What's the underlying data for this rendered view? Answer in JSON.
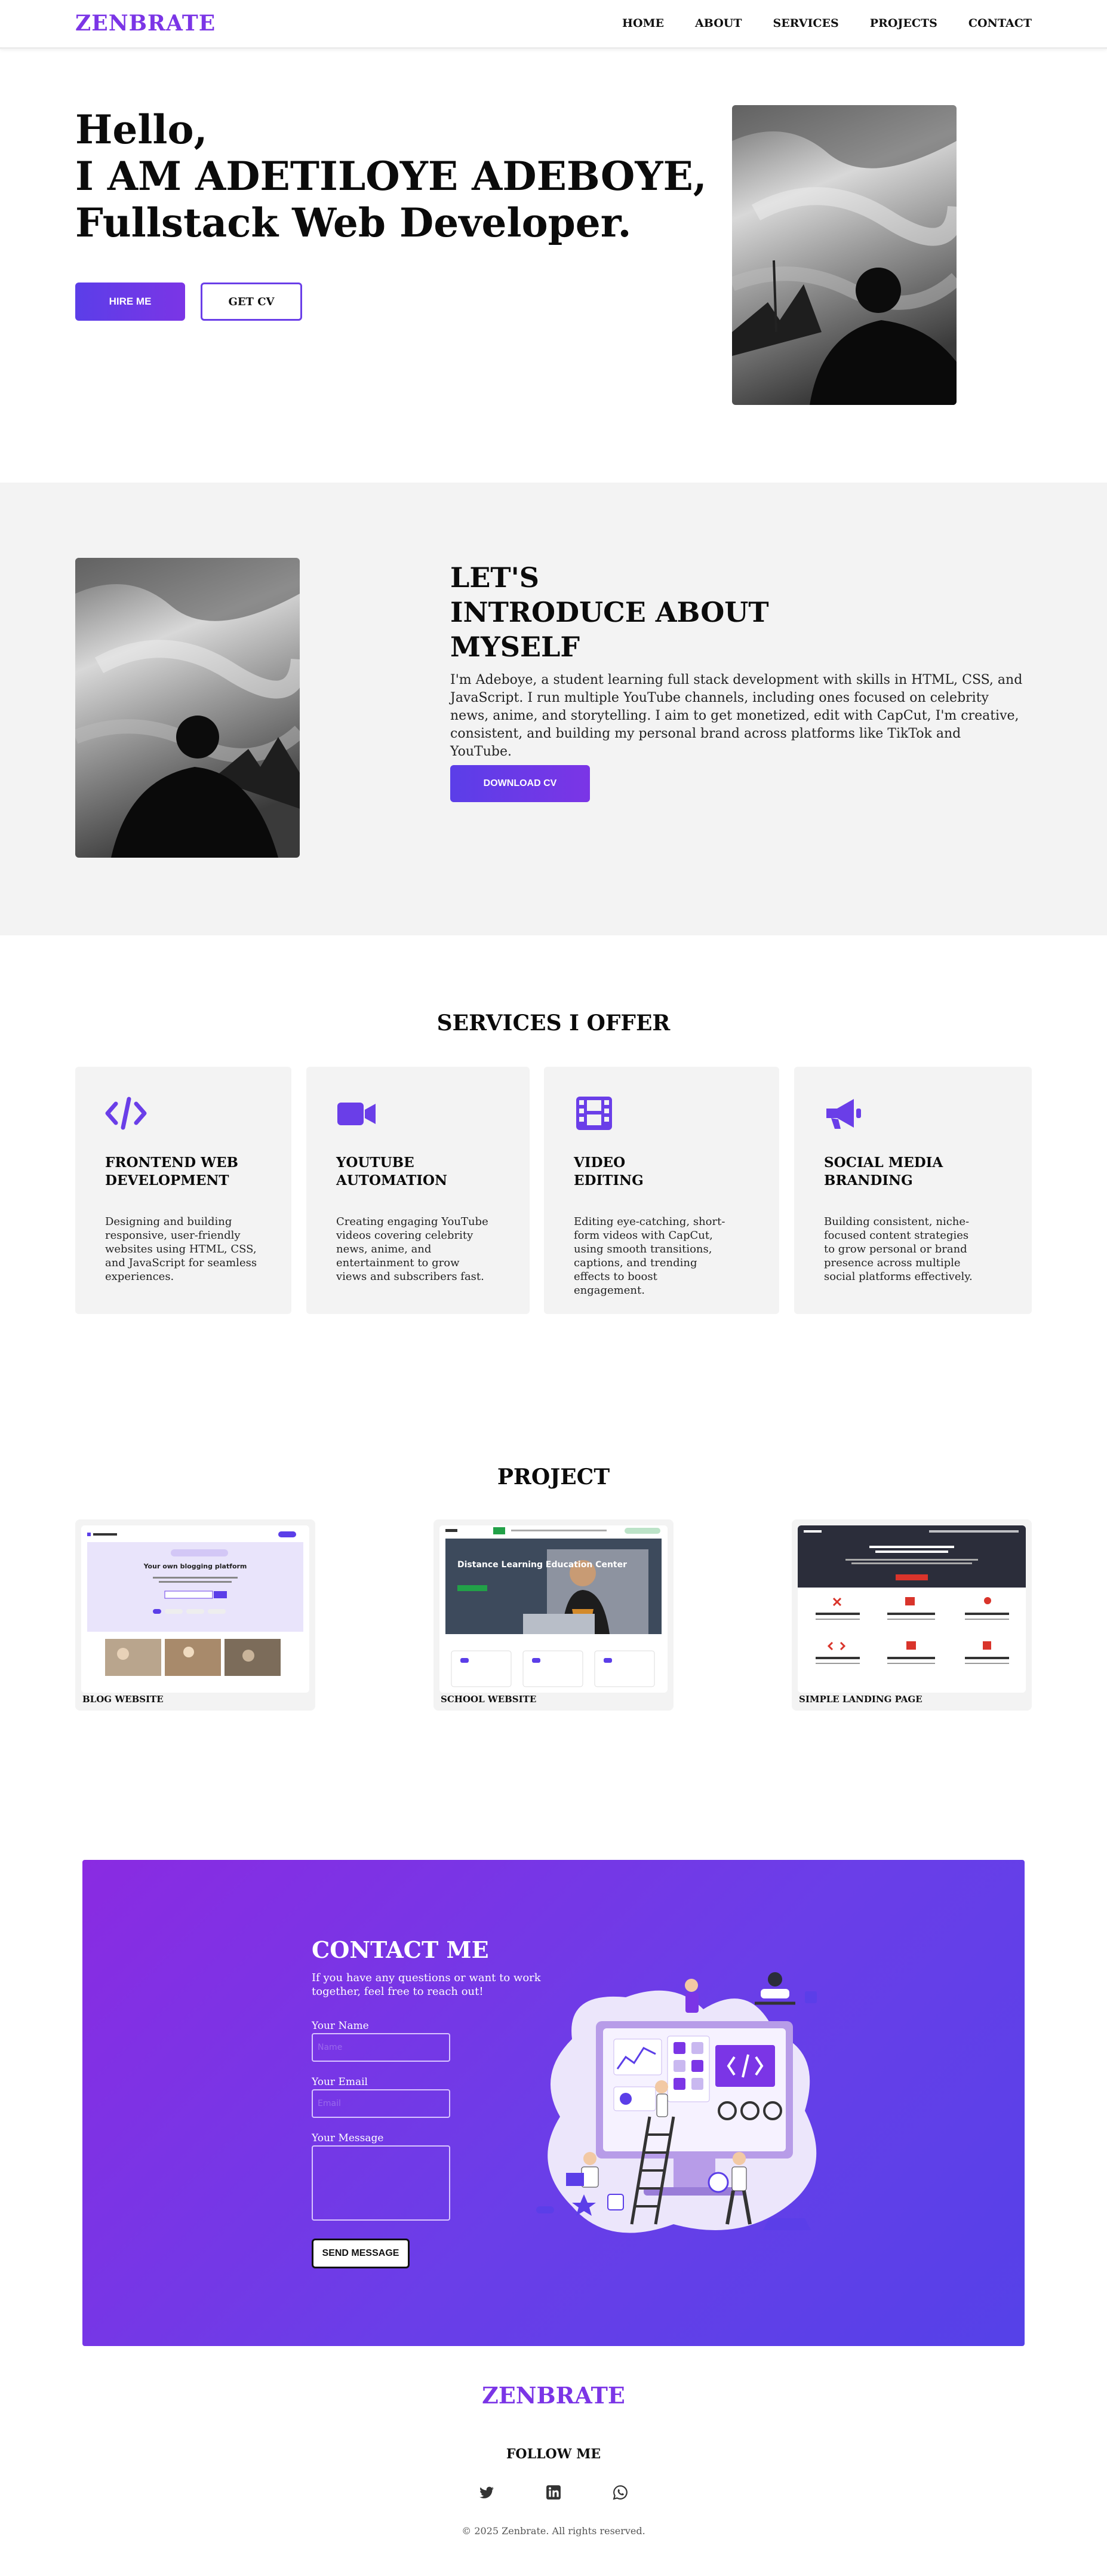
{
  "nav": {
    "logo": "ZENBRATE",
    "links": [
      "HOME",
      "ABOUT",
      "SERVICES",
      "PROJECTS",
      "CONTACT"
    ]
  },
  "hero": {
    "line1": "Hello,",
    "line2": "I AM ADETILOYE ADEBOYE,",
    "line3": "Fullstack Web Developer.",
    "hire_label": "HIRE ME",
    "cv_label": "GET CV"
  },
  "about": {
    "title_line1": "LET'S",
    "title_line2": "INTRODUCE ABOUT",
    "title_line3": "MYSELF",
    "text": "I'm Adeboye, a student learning full stack development with skills in HTML, CSS, and JavaScript. I run multiple YouTube channels, including ones focused on celebrity news, anime, and storytelling. I aim to get monetized, edit with CapCut, I'm creative, consistent, and building my personal brand across platforms like TikTok and YouTube.",
    "download_label": "DOWNLOAD CV"
  },
  "services": {
    "title": "SERVICES I OFFER",
    "items": [
      {
        "icon": "code-icon",
        "title1": "FRONTEND WEB",
        "title2": "DEVELOPMENT",
        "desc": "Designing and building responsive, user-friendly websites using HTML, CSS, and JavaScript for seamless experiences."
      },
      {
        "icon": "video-camera-icon",
        "title1": "YOUTUBE",
        "title2": "AUTOMATION",
        "desc": "Creating engaging YouTube videos covering celebrity news, anime, and entertainment to grow views and subscribers fast."
      },
      {
        "icon": "film-icon",
        "title1": "VIDEO",
        "title2": "EDITING",
        "desc": "Editing eye-catching, short-form videos with CapCut, using smooth transitions, captions, and trending effects to boost engagement."
      },
      {
        "icon": "megaphone-icon",
        "title1": "SOCIAL MEDIA",
        "title2": "BRANDING",
        "desc": "Building consistent, niche-focused content strategies to grow personal or brand presence across multiple social platforms effectively."
      }
    ]
  },
  "projects": {
    "title": "PROJECT",
    "items": [
      {
        "label": "BLOG WEBSITE",
        "thumb_title": "Your own blogging platform"
      },
      {
        "label": "SCHOOL WEBSITE",
        "thumb_title": "Distance Learning Education Center"
      },
      {
        "label": "SIMPLE LANDING PAGE",
        "thumb_title": ""
      }
    ]
  },
  "contact": {
    "title": "CONTACT ME",
    "subtitle": "If you have any questions or want to work together, feel free to reach out!",
    "name_label": "Your Name",
    "name_placeholder": "Name",
    "email_label": "Your Email",
    "email_placeholder": "Email",
    "message_label": "Your Message",
    "send_label": "SEND MESSAGE"
  },
  "footer": {
    "logo": "ZENBRATE",
    "follow": "FOLLOW ME",
    "socials": [
      "twitter-icon",
      "linkedin-icon",
      "whatsapp-icon"
    ],
    "copyright": "© 2025 Zenbrate. All rights reserved."
  },
  "colors": {
    "accent": "#7b35e6",
    "gradient_start": "#8a2be2",
    "gradient_end": "#5541e8",
    "panel": "#f3f3f3"
  }
}
